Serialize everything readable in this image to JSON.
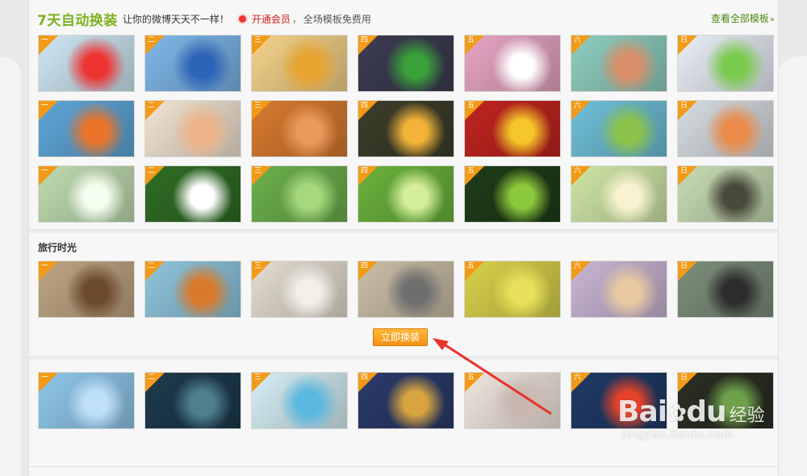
{
  "header": {
    "title": "7天自动换装",
    "subtitle": "让你的微博天天不一样！",
    "vip_link": "开通会员",
    "separator": "，",
    "free_text": "全场模板免费用",
    "view_all": "查看全部模板",
    "view_all_arrow": "»"
  },
  "days": [
    "一",
    "二",
    "三",
    "四",
    "五",
    "六",
    "日"
  ],
  "rows": [
    {
      "theme": "cartoon-disney",
      "colors": [
        "#cfe6f3",
        "#7fb7e8",
        "#f4d38a",
        "#3c3c52",
        "#e7a5c3",
        "#8fcfc0",
        "#e9eef6"
      ],
      "accents": [
        "#e33",
        "#2d64b8",
        "#e8a430",
        "#3aa03a",
        "#fff",
        "#d98f6a",
        "#7acb4d"
      ]
    },
    {
      "theme": "orange-cartoon",
      "colors": [
        "#5ea6d8",
        "#f1e4d3",
        "#d87a2e",
        "#3d3d2a",
        "#c0241f",
        "#6fc0d8",
        "#d6dde2"
      ],
      "accents": [
        "#e9742a",
        "#eeb48a",
        "#ea9a5c",
        "#f2b338",
        "#f5c62a",
        "#8bc34a",
        "#ea8b4b"
      ]
    },
    {
      "theme": "green-nature",
      "colors": [
        "#bfdcb0",
        "#2f6d24",
        "#6cb04c",
        "#6bb23c",
        "#1f3c18",
        "#cfe6a6",
        "#c7dcb4"
      ],
      "accents": [
        "#f5fff0",
        "#ffffff",
        "#a6d87e",
        "#d4ef99",
        "#8cc83b",
        "#f8f2d0",
        "#4a4a3a"
      ]
    }
  ],
  "section2": {
    "title": "旅行时光",
    "colors": [
      "#bfa584",
      "#8fc5dd",
      "#e4ddd0",
      "#cbbfa8",
      "#d7d14a",
      "#c9b6d4",
      "#7c8f7a"
    ],
    "accents": [
      "#6c4a2c",
      "#d97a2a",
      "#f2efe8",
      "#6e6e6e",
      "#e6e05a",
      "#e8c9a2",
      "#2c2c2c"
    ]
  },
  "apply_button": "立即换装",
  "row5": {
    "colors": [
      "#8fc6ea",
      "#1d3a4c",
      "#d5eff4",
      "#2b3a6b",
      "#f0e6e0",
      "#1f3a66",
      "#2a2e24"
    ],
    "accents": [
      "#bfe0f6",
      "#4f7f8e",
      "#5ab7e0",
      "#d8a440",
      "#c9b8b0",
      "#e8432a",
      "#6ea14a"
    ]
  },
  "watermark": {
    "logo": "Bai",
    "logo_paw": "du",
    "cn": "经验",
    "url": "jingyan.baidu.com"
  }
}
